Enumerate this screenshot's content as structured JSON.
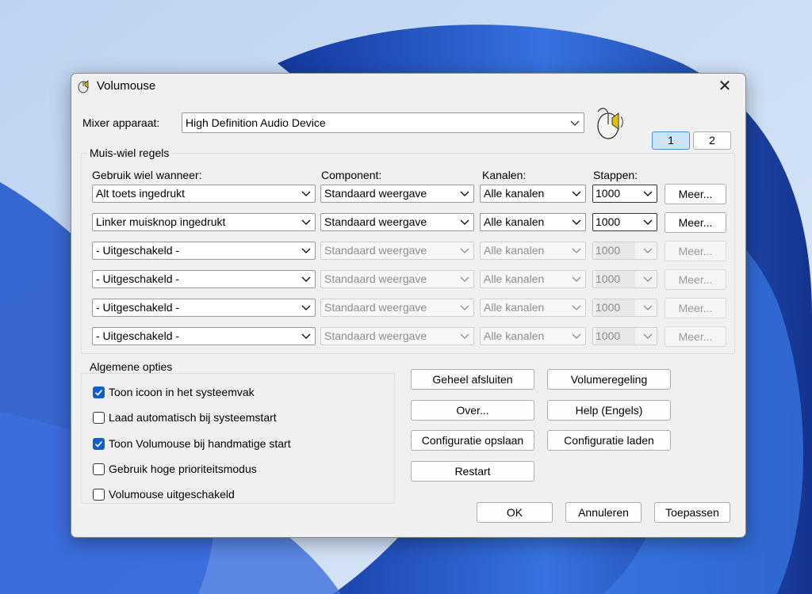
{
  "window": {
    "title": "Volumouse",
    "close_label": "✕"
  },
  "mixer": {
    "label": "Mixer apparaat:",
    "value": "High Definition Audio Device"
  },
  "pages": [
    "1",
    "2"
  ],
  "rules": {
    "group_title": "Muis-wiel regels",
    "headers": {
      "trigger": "Gebruik wiel wanneer:",
      "component": "Component:",
      "channels": "Kanalen:",
      "steps": "Stappen:"
    },
    "rows": [
      {
        "trigger": "Alt toets ingedrukt",
        "component": "Standaard weergave",
        "channels": "Alle kanalen",
        "steps": "1000",
        "more": "Meer...",
        "enabled": true
      },
      {
        "trigger": "Linker muisknop ingedrukt",
        "component": "Standaard weergave",
        "channels": "Alle kanalen",
        "steps": "1000",
        "more": "Meer...",
        "enabled": true
      },
      {
        "trigger": "- Uitgeschakeld -",
        "component": "Standaard weergave",
        "channels": "Alle kanalen",
        "steps": "1000",
        "more": "Meer...",
        "enabled": false
      },
      {
        "trigger": "- Uitgeschakeld -",
        "component": "Standaard weergave",
        "channels": "Alle kanalen",
        "steps": "1000",
        "more": "Meer...",
        "enabled": false
      },
      {
        "trigger": "- Uitgeschakeld -",
        "component": "Standaard weergave",
        "channels": "Alle kanalen",
        "steps": "1000",
        "more": "Meer...",
        "enabled": false
      },
      {
        "trigger": "- Uitgeschakeld -",
        "component": "Standaard weergave",
        "channels": "Alle kanalen",
        "steps": "1000",
        "more": "Meer...",
        "enabled": false
      }
    ]
  },
  "options": {
    "group_title": "Algemene opties",
    "items": [
      {
        "label": "Toon icoon in het systeemvak",
        "checked": true
      },
      {
        "label": "Laad automatisch bij systeemstart",
        "checked": false
      },
      {
        "label": "Toon Volumouse bij handmatige start",
        "checked": true
      },
      {
        "label": "Gebruik hoge prioriteitsmodus",
        "checked": false
      },
      {
        "label": "Volumouse uitgeschakeld",
        "checked": false
      }
    ]
  },
  "actions": {
    "exit": "Geheel afsluiten",
    "volume": "Volumeregeling",
    "about": "Over...",
    "help": "Help (Engels)",
    "save_config": "Configuratie opslaan",
    "load_config": "Configuratie laden",
    "restart": "Restart"
  },
  "footer": {
    "ok": "OK",
    "cancel": "Annuleren",
    "apply": "Toepassen"
  }
}
